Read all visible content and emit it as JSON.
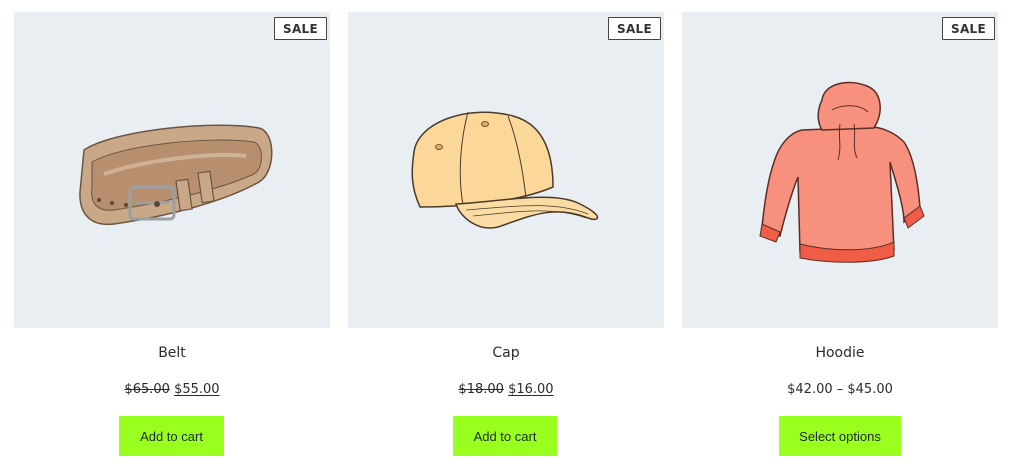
{
  "products": [
    {
      "name": "Belt",
      "badge": "SALE",
      "price_old": "$65.00",
      "price_new": "$55.00",
      "button_label": "Add to cart"
    },
    {
      "name": "Cap",
      "badge": "SALE",
      "price_old": "$18.00",
      "price_new": "$16.00",
      "button_label": "Add to cart"
    },
    {
      "name": "Hoodie",
      "badge": "SALE",
      "price_range": "$42.00 – $45.00",
      "button_label": "Select options"
    }
  ],
  "colors": {
    "thumb_background": "#e9eef3",
    "button_background": "#99ff1f",
    "badge_border": "#444444"
  }
}
